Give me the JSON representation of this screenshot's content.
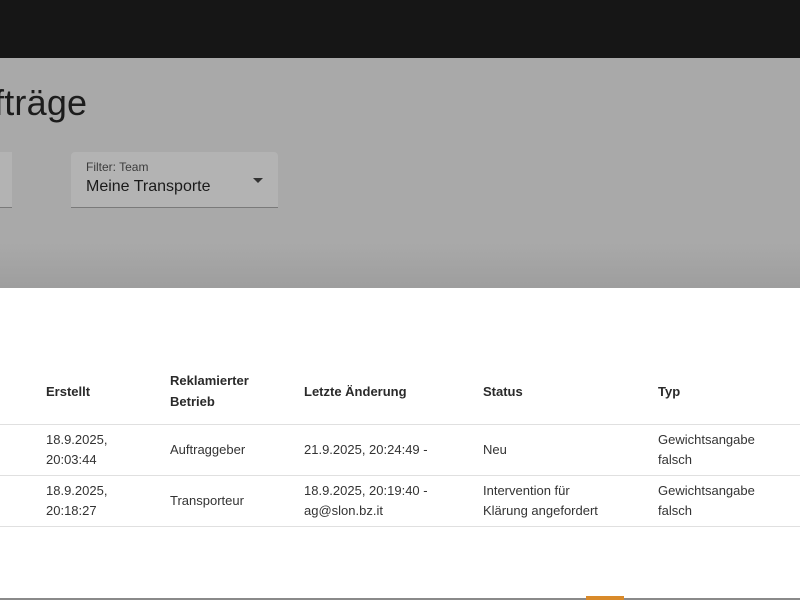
{
  "header": {
    "title": "fträge",
    "filter_team": {
      "label": "Filter: Team",
      "value": "Meine Transporte",
      "icon": "chevron-down-icon"
    }
  },
  "table": {
    "columns": {
      "created": "Erstellt",
      "company_line1": "Reklamierter",
      "company_line2": "Betrieb",
      "last_change": "Letzte Änderung",
      "status": "Status",
      "type": "Typ"
    },
    "rows": [
      {
        "created_date": "18.9.2025,",
        "created_time": "20:03:44",
        "company": "Auftraggeber",
        "last_change_line1": "21.9.2025, 20:24:49 -",
        "last_change_line2": "",
        "status_line1": "Neu",
        "status_line2": "",
        "type_line1": "Gewichtsangabe",
        "type_line2": "falsch"
      },
      {
        "created_date": "18.9.2025,",
        "created_time": "20:18:27",
        "company": "Transporteur",
        "last_change_line1": "18.9.2025, 20:19:40 -",
        "last_change_line2": "ag@slon.bz.it",
        "status_line1": "Intervention für",
        "status_line2": "Klärung angefordert",
        "type_line1": "Gewichtsangabe",
        "type_line2": "falsch"
      }
    ]
  }
}
